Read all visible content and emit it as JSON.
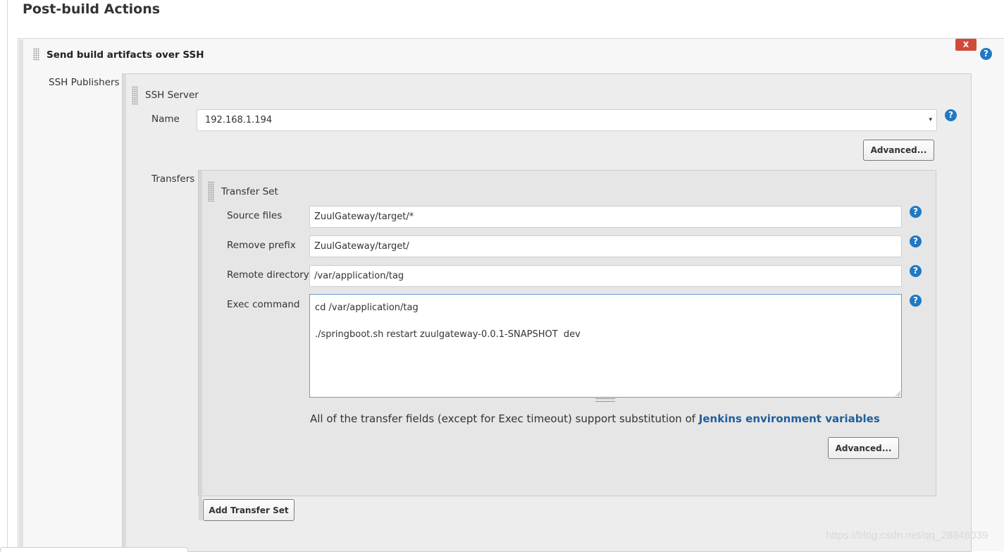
{
  "section": {
    "title": "Post-build Actions"
  },
  "step": {
    "title": "Send build artifacts over SSH",
    "close_label": "X",
    "help_label": "?"
  },
  "publishers": {
    "label": "SSH Publishers",
    "server": {
      "title": "SSH Server",
      "name_label": "Name",
      "name_value": "192.168.1.194",
      "caret": "▾",
      "advanced_label": "Advanced..."
    },
    "transfers": {
      "label": "Transfers",
      "set": {
        "title": "Transfer Set",
        "source_files_label": "Source files",
        "source_files_value": "ZuulGateway/target/*",
        "remove_prefix_label": "Remove prefix",
        "remove_prefix_value": "ZuulGateway/target/",
        "remote_directory_label": "Remote directory",
        "remote_directory_value": "/var/application/tag",
        "exec_command_label": "Exec command",
        "exec_command_lines": [
          "cd /var/application/tag",
          "",
          "./springboot.sh restart zuulgateway-0.0.1-SNAPSHOT  dev"
        ],
        "note_text": "All of the transfer fields (except for Exec timeout) support substitution of ",
        "note_link": "Jenkins environment variables",
        "advanced_label": "Advanced..."
      },
      "add_label": "Add Transfer Set"
    }
  },
  "watermark": "https://blog.csdn.net/qq_28846039",
  "colors": {
    "close": "#d24939",
    "help": "#1f79c4",
    "link": "#1f5f9e"
  }
}
